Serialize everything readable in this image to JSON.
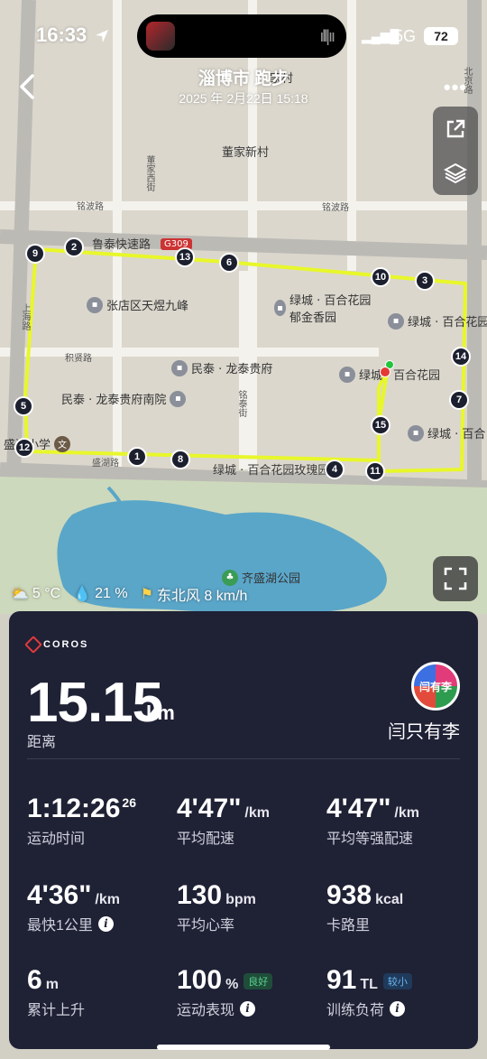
{
  "status_bar": {
    "time": "16:33",
    "network": "5G",
    "battery": "72"
  },
  "header": {
    "title": "淄博市 跑步",
    "datetime": "2025 年 2月22日 15:18"
  },
  "map": {
    "labels": {
      "dongjia": "董家新村",
      "dongjia_road": "董家西街",
      "mingbo_road": "铭波路",
      "mingbo_road_w": "铭波路",
      "lutai": "鲁泰快速路",
      "g309": "G309",
      "zhangdian": "张店区天煜九峰",
      "lvcheng1": "绿城 · 百合花园郁金香园",
      "lvcheng2": "绿城 · 百合花园",
      "minta1": "民泰 · 龙泰贵府",
      "minta2": "民泰 · 龙泰贵府南院",
      "lvcheng3": "绿城",
      "baihe": "百合花园",
      "lvcheng4": "绿城 · 百合",
      "shanghai_road": "上海路",
      "jixian_road": "积贤路",
      "shenghu": "盛湖路",
      "lvcheng5": "绿城 · 百合花园玫瑰园",
      "school": "盛湖小学",
      "park": "齐盛湖公园",
      "village": "家村",
      "beijing_road": "北京路",
      "mingjing": "铭泰街"
    },
    "km_markers": [
      "1",
      "2",
      "3",
      "4",
      "5",
      "6",
      "7",
      "8",
      "9",
      "10",
      "11",
      "12",
      "13",
      "14",
      "15"
    ]
  },
  "weather": {
    "temp": "5 °C",
    "humidity": "21 %",
    "wind": "东北风 8 km/h"
  },
  "card": {
    "brand": "COROS",
    "distance": "15.15",
    "distance_unit": "km",
    "distance_label": "距离",
    "avatar_text": "闫有李",
    "username": "闫只有李",
    "stats": {
      "time": {
        "value": "1:12:26",
        "sup": "26",
        "label": "运动时间"
      },
      "pace": {
        "value": "4'47\"",
        "unit": "/km",
        "label": "平均配速"
      },
      "gap": {
        "value": "4'47\"",
        "unit": "/km",
        "label": "平均等强配速"
      },
      "fastest": {
        "value": "4'36\"",
        "unit": "/km",
        "label": "最快1公里"
      },
      "hr": {
        "value": "130",
        "unit": "bpm",
        "label": "平均心率"
      },
      "cal": {
        "value": "938",
        "unit": "kcal",
        "label": "卡路里"
      },
      "elev": {
        "value": "6",
        "unit": "m",
        "label": "累计上升"
      },
      "perf": {
        "value": "100",
        "unit": "%",
        "badge": "良好",
        "label": "运动表现"
      },
      "load": {
        "value": "91",
        "unit": "TL",
        "badge": "较小",
        "label": "训练负荷"
      }
    }
  },
  "colors": {
    "route": "#e8f72a",
    "card_bg": "#1f2135",
    "water": "#5aa6c9"
  }
}
